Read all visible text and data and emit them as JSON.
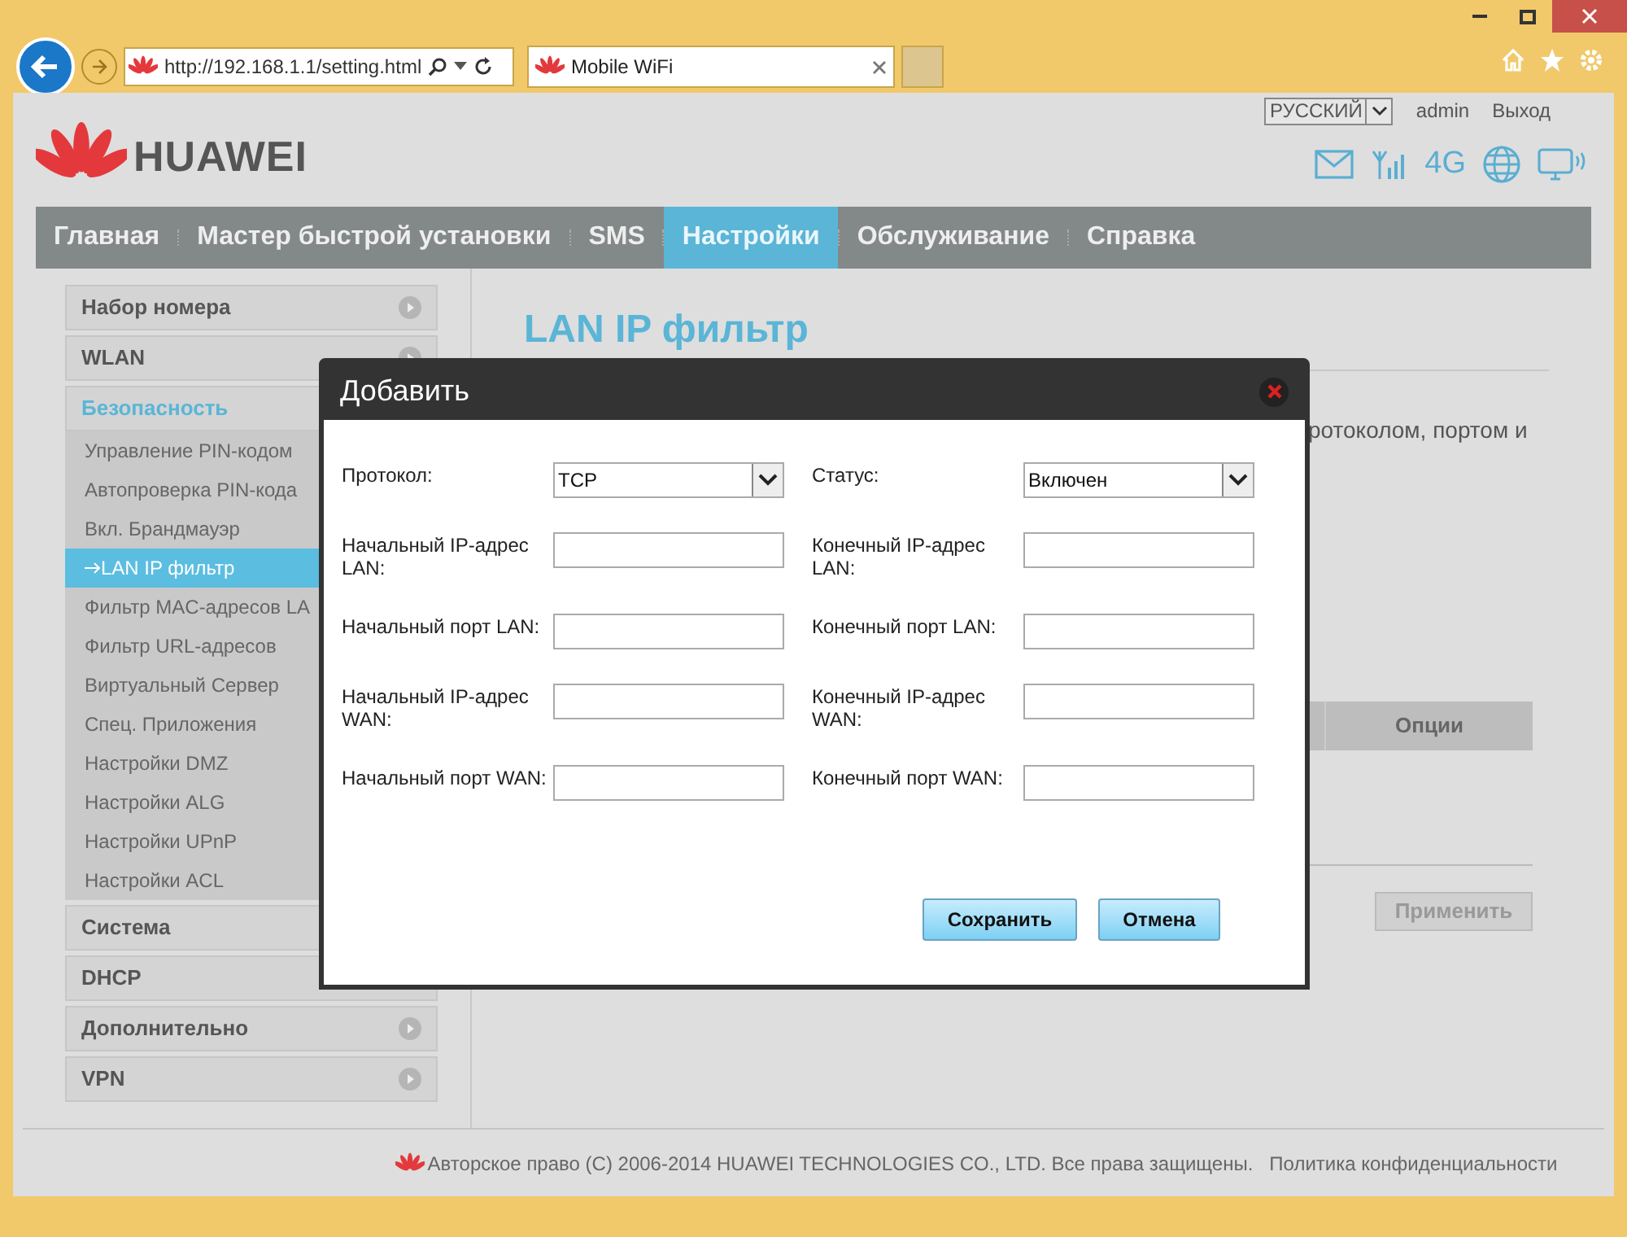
{
  "browser": {
    "address": "http://192.168.1.1/setting.html",
    "tabs": [
      {
        "title": "Mobile WiFi",
        "selected": true
      }
    ]
  },
  "header": {
    "brand": "HUAWEI",
    "language": "РУССКИЙ",
    "user": "admin",
    "logout": "Выход",
    "network": "4G"
  },
  "nav": [
    {
      "label": "Главная",
      "selected": false
    },
    {
      "label": "Мастер быстрой установки",
      "selected": false
    },
    {
      "label": "SMS",
      "selected": false
    },
    {
      "label": "Настройки",
      "selected": true
    },
    {
      "label": "Обслуживание",
      "selected": false
    },
    {
      "label": "Справка",
      "selected": false
    }
  ],
  "sidebar": [
    {
      "label": "Набор номера",
      "expanded": false
    },
    {
      "label": "WLAN",
      "expanded": false
    },
    {
      "label": "Безопасность",
      "expanded": true,
      "children": [
        {
          "label": "Управление PIN-кодом",
          "selected": false
        },
        {
          "label": "Автопроверка PIN-кода",
          "selected": false
        },
        {
          "label": "Вкл. Брандмауэр",
          "selected": false
        },
        {
          "label": "LAN IP фильтр",
          "selected": true
        },
        {
          "label": "Фильтр MAC-адресов LA",
          "selected": false
        },
        {
          "label": "Фильтр URL-адресов",
          "selected": false
        },
        {
          "label": "Виртуальный Сервер",
          "selected": false
        },
        {
          "label": "Спец. Приложения",
          "selected": false
        },
        {
          "label": "Настройки DMZ",
          "selected": false
        },
        {
          "label": "Настройки ALG",
          "selected": false
        },
        {
          "label": "Настройки UPnP",
          "selected": false
        },
        {
          "label": "Настройки ACL",
          "selected": false
        }
      ]
    },
    {
      "label": "Система",
      "expanded": false
    },
    {
      "label": "DHCP",
      "expanded": false
    },
    {
      "label": "Дополнительно",
      "expanded": false
    },
    {
      "label": "VPN",
      "expanded": false
    }
  ],
  "content": {
    "title": "LAN IP фильтр",
    "description_fragment": "ротоколом, портом и",
    "table": {
      "columns": [
        "Опции"
      ]
    },
    "apply_button": {
      "label": "Применить",
      "disabled": true
    }
  },
  "dialog": {
    "title": "Добавить",
    "fields": [
      {
        "label": "Протокол:",
        "kind": "select",
        "value": "TCP"
      },
      {
        "label": "Статус:",
        "kind": "select",
        "value": "Включен"
      },
      {
        "label": "Начальный IP-адрес LAN:",
        "kind": "text"
      },
      {
        "label": "Конечный IP-адрес LAN:",
        "kind": "text"
      },
      {
        "label": "Начальный порт LAN:",
        "kind": "text"
      },
      {
        "label": "Конечный порт LAN:",
        "kind": "text"
      },
      {
        "label": "Начальный IP-адрес WAN:",
        "kind": "text"
      },
      {
        "label": "Конечный IP-адрес WAN:",
        "kind": "text"
      },
      {
        "label": "Начальный порт WAN:",
        "kind": "text"
      },
      {
        "label": "Конечный порт WAN:",
        "kind": "text"
      }
    ],
    "buttons": [
      "Сохранить",
      "Отмена"
    ]
  },
  "footer": {
    "copyright": "Авторское право (C) 2006-2014 HUAWEI TECHNOLOGIES CO., LTD. Все права защищены.",
    "privacy": "Политика конфиденциальности"
  }
}
